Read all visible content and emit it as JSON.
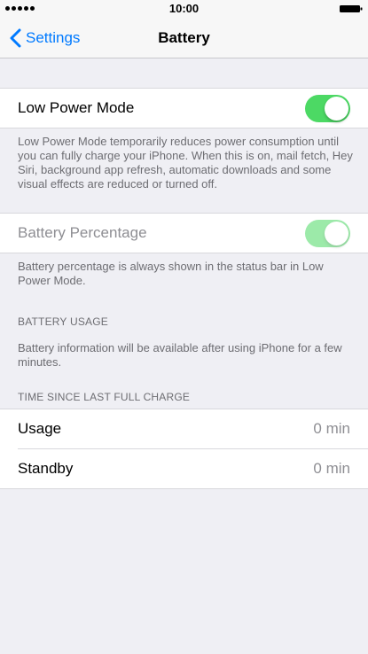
{
  "status_bar": {
    "time": "10:00",
    "signal_icon": "signal-dots-icon",
    "battery_icon": "battery-full-icon"
  },
  "nav": {
    "back_label": "Settings",
    "back_icon": "chevron-left-icon",
    "title": "Battery"
  },
  "low_power": {
    "label": "Low Power Mode",
    "toggle_on": true,
    "footer": "Low Power Mode temporarily reduces power consumption until you can fully charge your iPhone. When this is on, mail fetch, Hey Siri, background app refresh, automatic downloads and some visual effects are reduced or turned off."
  },
  "battery_percentage": {
    "label": "Battery Percentage",
    "toggle_on": true,
    "enabled": false,
    "footer": "Battery percentage is always shown in the status bar in Low Power Mode."
  },
  "battery_usage": {
    "header": "BATTERY USAGE",
    "footer": "Battery information will be available after using iPhone for a few minutes."
  },
  "time_since_charge": {
    "header": "TIME SINCE LAST FULL CHARGE",
    "rows": [
      {
        "label": "Usage",
        "value": "0 min"
      },
      {
        "label": "Standby",
        "value": "0 min"
      }
    ]
  },
  "colors": {
    "accent": "#007aff",
    "toggle_on": "#4cd964",
    "background": "#efeff4"
  }
}
